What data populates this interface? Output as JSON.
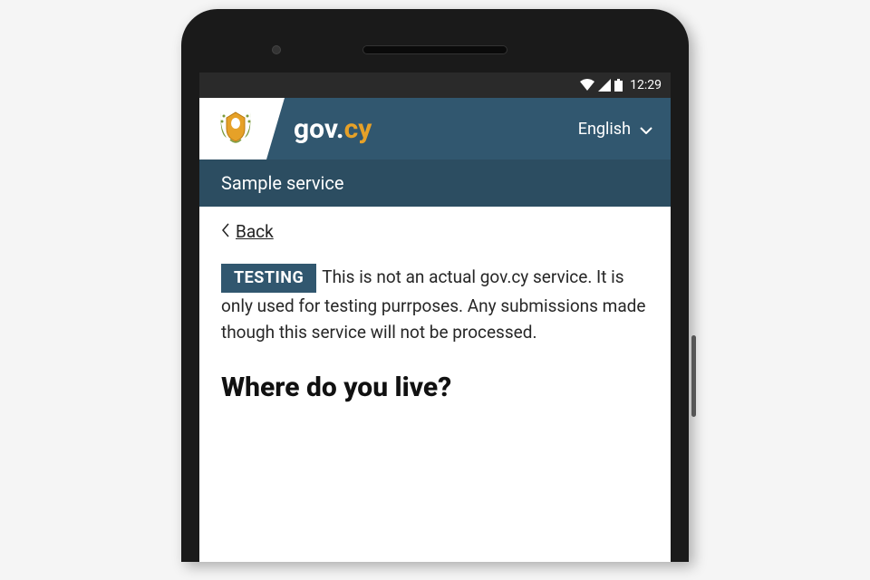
{
  "statusbar": {
    "time": "12:29"
  },
  "header": {
    "brand_prefix": "gov.",
    "brand_suffix": "cy",
    "language_label": "English"
  },
  "subheader": {
    "service_name": "Sample service"
  },
  "back": {
    "label": "Back"
  },
  "notice": {
    "tag": "TESTING",
    "text": "This is not an actual gov.cy service. It is only used for testing purrposes. Any submissions made though this service will not be processed."
  },
  "question": {
    "heading": "Where do you live?"
  }
}
